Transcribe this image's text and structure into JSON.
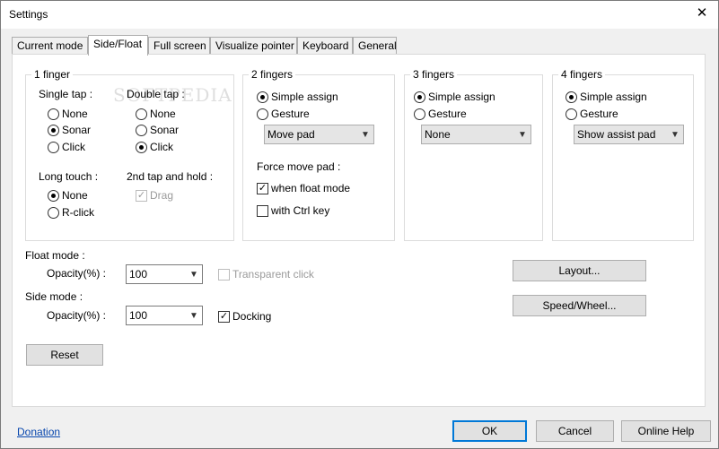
{
  "window": {
    "title": "Settings",
    "close_glyph": "✕"
  },
  "tabs": [
    "Current mode",
    "Side/Float",
    "Full screen",
    "Visualize pointer",
    "Keyboard",
    "General"
  ],
  "watermark": "SOFTPEDIA",
  "one_finger": {
    "title": "1 finger",
    "single_tap": {
      "label": "Single tap :",
      "options": [
        "None",
        "Sonar",
        "Click"
      ],
      "selected": "Sonar"
    },
    "double_tap": {
      "label": "Double tap :",
      "options": [
        "None",
        "Sonar",
        "Click"
      ],
      "selected": "Click"
    },
    "long_touch": {
      "label": "Long touch :",
      "options": [
        "None",
        "R-click"
      ],
      "selected": "None"
    },
    "second_tap_hold": {
      "label": "2nd tap and hold :",
      "drag_label": "Drag",
      "drag_checked": true,
      "drag_enabled": false
    }
  },
  "two_fingers": {
    "title": "2 fingers",
    "options": [
      "Simple assign",
      "Gesture"
    ],
    "selected": "Simple assign",
    "dropdown_value": "Move pad",
    "force_move_label": "Force move pad :",
    "when_float_label": "when float mode",
    "when_float_checked": true,
    "with_ctrl_label": "with Ctrl key",
    "with_ctrl_checked": false
  },
  "three_fingers": {
    "title": "3 fingers",
    "options": [
      "Simple assign",
      "Gesture"
    ],
    "selected": "Simple assign",
    "dropdown_value": "None"
  },
  "four_fingers": {
    "title": "4 fingers",
    "options": [
      "Simple assign",
      "Gesture"
    ],
    "selected": "Simple assign",
    "dropdown_value": "Show assist pad"
  },
  "float_mode": {
    "label": "Float mode :",
    "opacity_label": "Opacity(%) :",
    "opacity_value": "100",
    "transparent_label": "Transparent click",
    "transparent_checked": false
  },
  "side_mode": {
    "label": "Side mode :",
    "opacity_label": "Opacity(%) :",
    "opacity_value": "100",
    "docking_label": "Docking",
    "docking_checked": true
  },
  "buttons": {
    "layout": "Layout...",
    "speed_wheel": "Speed/Wheel...",
    "reset": "Reset",
    "ok": "OK",
    "cancel": "Cancel",
    "online_help": "Online Help"
  },
  "donation_link": "Donation"
}
